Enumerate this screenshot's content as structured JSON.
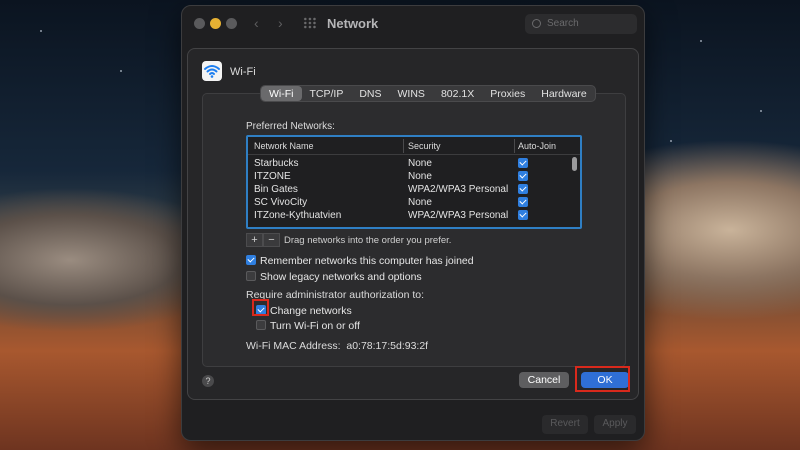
{
  "window": {
    "title": "Network",
    "search_placeholder": "Search",
    "revert_label": "Revert",
    "apply_label": "Apply"
  },
  "sheet": {
    "title": "Wi-Fi",
    "tabs": [
      "Wi-Fi",
      "TCP/IP",
      "DNS",
      "WINS",
      "802.1X",
      "Proxies",
      "Hardware"
    ],
    "active_tab": "Wi-Fi",
    "preferred_networks_label": "Preferred Networks:",
    "table": {
      "columns": [
        "Network Name",
        "Security",
        "Auto-Join"
      ],
      "rows": [
        {
          "name": "Starbucks",
          "security": "None",
          "auto_join": true
        },
        {
          "name": "ITZONE",
          "security": "None",
          "auto_join": true
        },
        {
          "name": "Bin Gates",
          "security": "WPA2/WPA3 Personal",
          "auto_join": true
        },
        {
          "name": "SC VivoCity",
          "security": "None",
          "auto_join": true
        },
        {
          "name": "ITZone-Kythuatvien",
          "security": "WPA2/WPA3 Personal",
          "auto_join": true
        }
      ]
    },
    "add_label": "+",
    "remove_label": "−",
    "drag_hint": "Drag networks into the order you prefer.",
    "options": {
      "remember": {
        "label": "Remember networks this computer has joined",
        "checked": true
      },
      "legacy": {
        "label": "Show legacy networks and options",
        "checked": false
      }
    },
    "require_label": "Require administrator authorization to:",
    "admin_options": {
      "change_networks": {
        "label": "Change networks",
        "checked": true
      },
      "turn_wifi": {
        "label": "Turn Wi-Fi on or off",
        "checked": false
      }
    },
    "mac_label": "Wi-Fi MAC Address:",
    "mac_value": "a0:78:17:5d:93:2f",
    "help_label": "?",
    "cancel_label": "Cancel",
    "ok_label": "OK"
  },
  "colors": {
    "accent": "#2f6fd6",
    "highlight": "#d9291c",
    "table_border": "#2f7fc4"
  }
}
